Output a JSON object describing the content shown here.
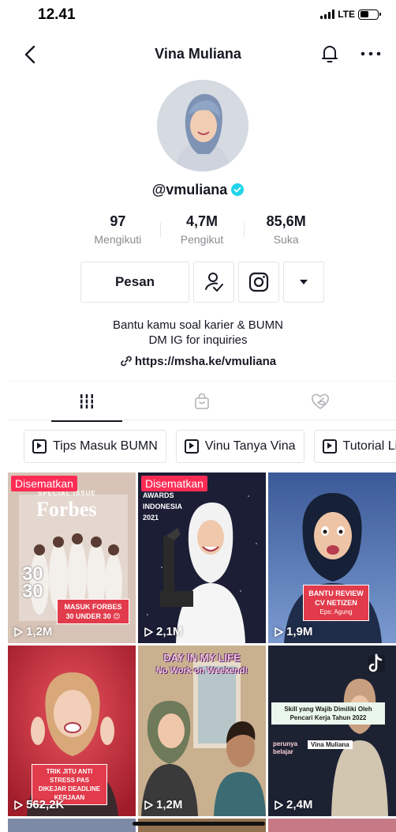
{
  "status_bar": {
    "time": "12.41",
    "network": "LTE",
    "battery_level": 0.5
  },
  "header": {
    "title": "Vina Muliana"
  },
  "profile": {
    "username": "@vmuliana",
    "stats": [
      {
        "value": "97",
        "label": "Mengikuti"
      },
      {
        "value": "4,7M",
        "label": "Pengikut"
      },
      {
        "value": "85,6M",
        "label": "Suka"
      }
    ],
    "message_button": "Pesan",
    "bio_line1": "Bantu kamu soal karier & BUMN",
    "bio_line2": "DM IG for inquiries",
    "link": "https://msha.ke/vmuliana"
  },
  "playlists": [
    {
      "label": "Tips Masuk BUMN"
    },
    {
      "label": "Vinu Tanya Vina"
    },
    {
      "label": "Tutorial LinkedIn"
    }
  ],
  "videos": [
    {
      "views": "1,2M",
      "pinned": "Disematkan",
      "headline": "Forbes",
      "tag": "SPECIAL ISSUE",
      "big": "30 30",
      "caption": "MASUK FORBES 30 UNDER 30 😊",
      "bg": "#d8c3b8"
    },
    {
      "views": "2,1M",
      "pinned": "Disematkan",
      "headline": "AWARDS INDONESIA 2021",
      "caption": "",
      "bg": "#1d1f3a"
    },
    {
      "views": "1,9M",
      "caption": "BANTU REVIEW CV NETIZEN",
      "sub": "Eps: Agung",
      "bg": "#4a6fa8"
    },
    {
      "views": "562,2K",
      "caption": "TRIK JITU ANTI STRESS PAS DIKEJAR DEADLINE KERJAAN",
      "bg": "#d8333f"
    },
    {
      "views": "1,2M",
      "headline": "DAY IN MY LIFE",
      "sub": "No Work on Weekend!",
      "bg": "#b99a78"
    },
    {
      "views": "2,4M",
      "caption": "Skill yang Wajib Dimiliki Oleh Pencari Kerja Tahun 2022",
      "tag": "Vina Muliana",
      "tag2": "perunya belajar",
      "bg": "#22283a"
    }
  ]
}
